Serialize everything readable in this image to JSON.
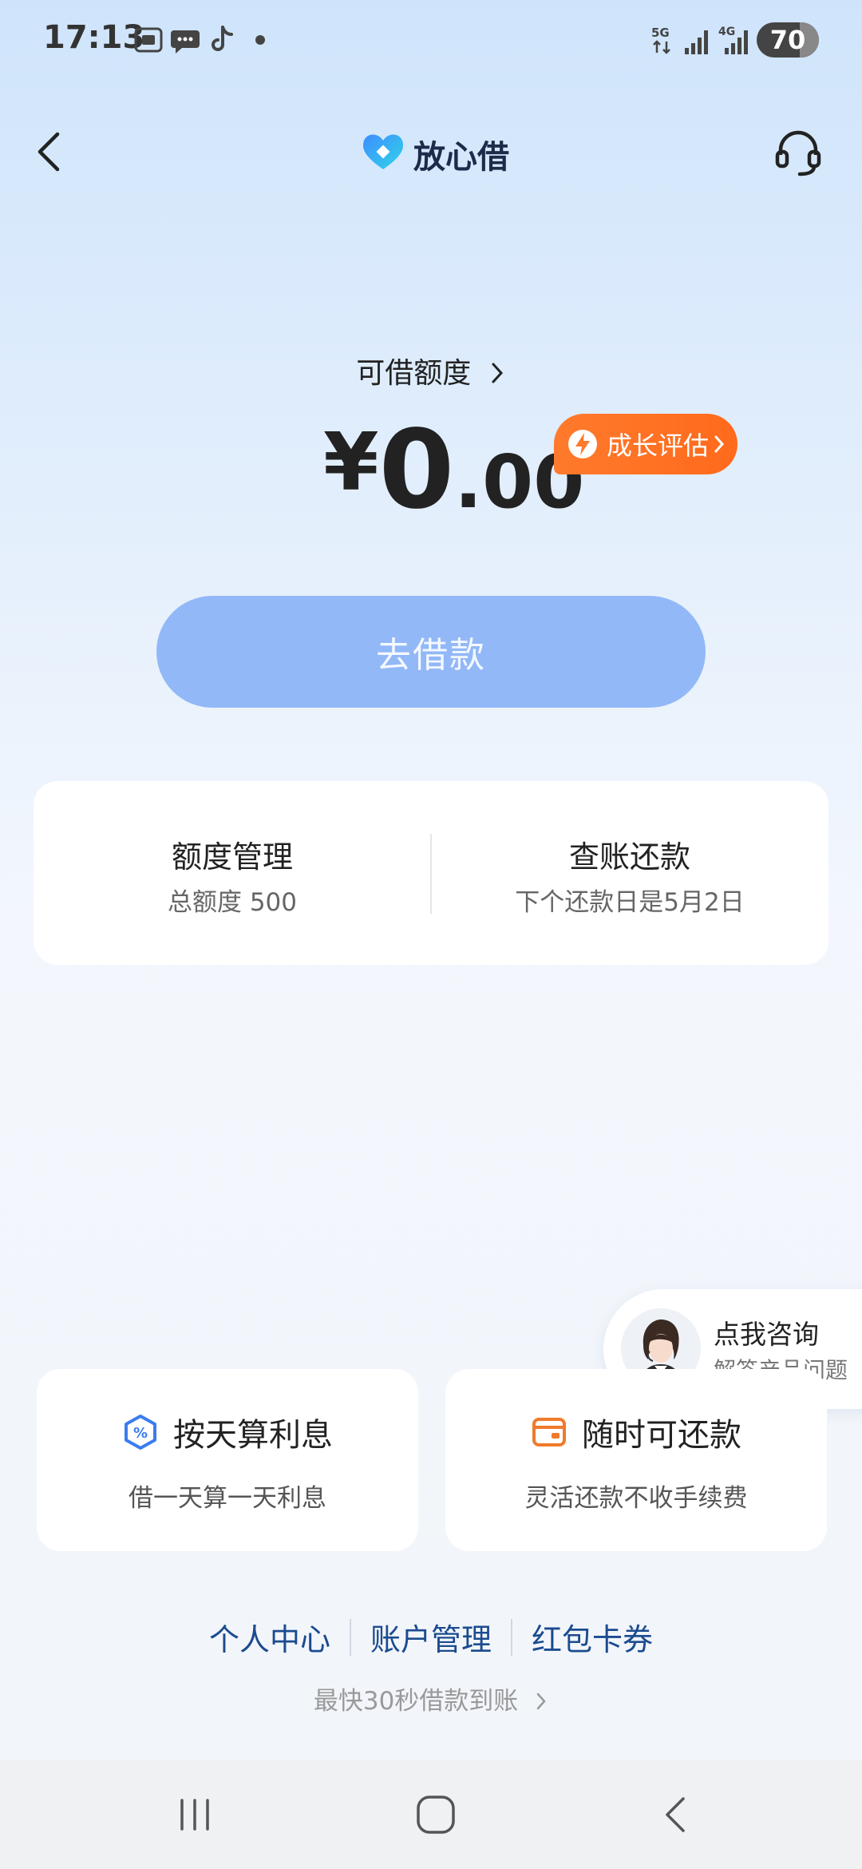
{
  "status_bar": {
    "time": "17:13",
    "network_5g": "5G",
    "network_4g": "4G",
    "battery": "70"
  },
  "header": {
    "title": "放心借"
  },
  "credit": {
    "label": "可借额度",
    "currency": "¥",
    "amount_int": "0",
    "amount_dec": ".00",
    "growth_badge": "成长评估"
  },
  "borrow_button": "去借款",
  "main_card": {
    "left": {
      "title": "额度管理",
      "subtitle": "总额度 500"
    },
    "right": {
      "title": "查账还款",
      "subtitle": "下个还款日是5月2日"
    }
  },
  "consult": {
    "title": "点我咨询",
    "subtitle": "解答产品问题"
  },
  "features": [
    {
      "title": "按天算利息",
      "subtitle": "借一天算一天利息",
      "icon": "percent-hexagon-icon"
    },
    {
      "title": "随时可还款",
      "subtitle": "灵活还款不收手续费",
      "icon": "wallet-card-icon"
    }
  ],
  "bottom_links": [
    "个人中心",
    "账户管理",
    "红包卡券"
  ],
  "tagline": "最快30秒借款到账",
  "colors": {
    "accent": "#92b8f8",
    "badge": "#ff6a1c",
    "link": "#1b4b8f"
  }
}
